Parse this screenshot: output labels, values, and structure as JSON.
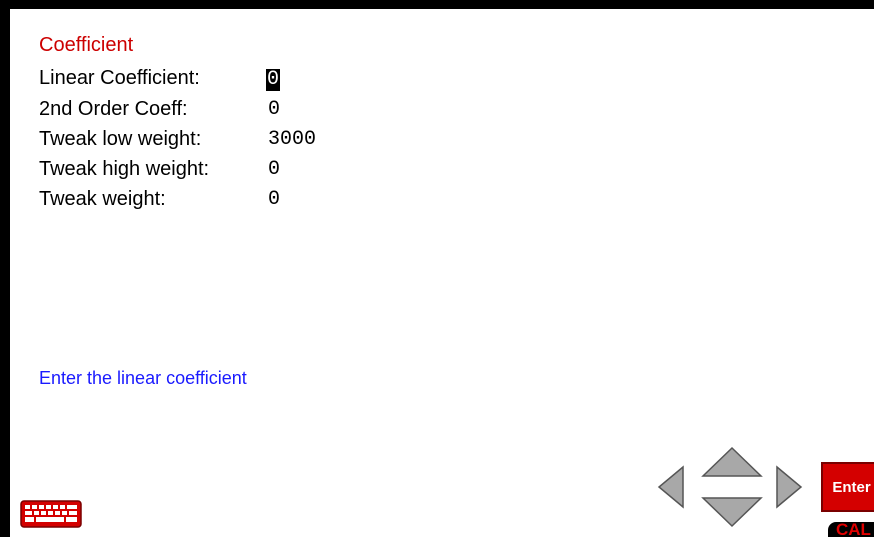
{
  "screen": {
    "title": "Coefficient",
    "hint": "Enter the linear coefficient"
  },
  "fields": [
    {
      "label": "Linear Coefficient:",
      "value": "0"
    },
    {
      "label": "2nd Order Coeff:",
      "value": "0"
    },
    {
      "label": "Tweak low weight:",
      "value": "3000"
    },
    {
      "label": "Tweak high weight:",
      "value": "0"
    },
    {
      "label": "Tweak weight:",
      "value": "0"
    }
  ],
  "buttons": {
    "enter": "Enter",
    "cal": "CAL"
  },
  "icons": {
    "keyboard": "keyboard-icon",
    "left": "arrow-left-icon",
    "up": "arrow-up-icon",
    "down": "arrow-down-icon",
    "right": "arrow-right-icon"
  },
  "colors": {
    "title": "#cc0000",
    "hint": "#1a1aff",
    "enter": "#d40000",
    "arrows": "#a8a8a8"
  }
}
